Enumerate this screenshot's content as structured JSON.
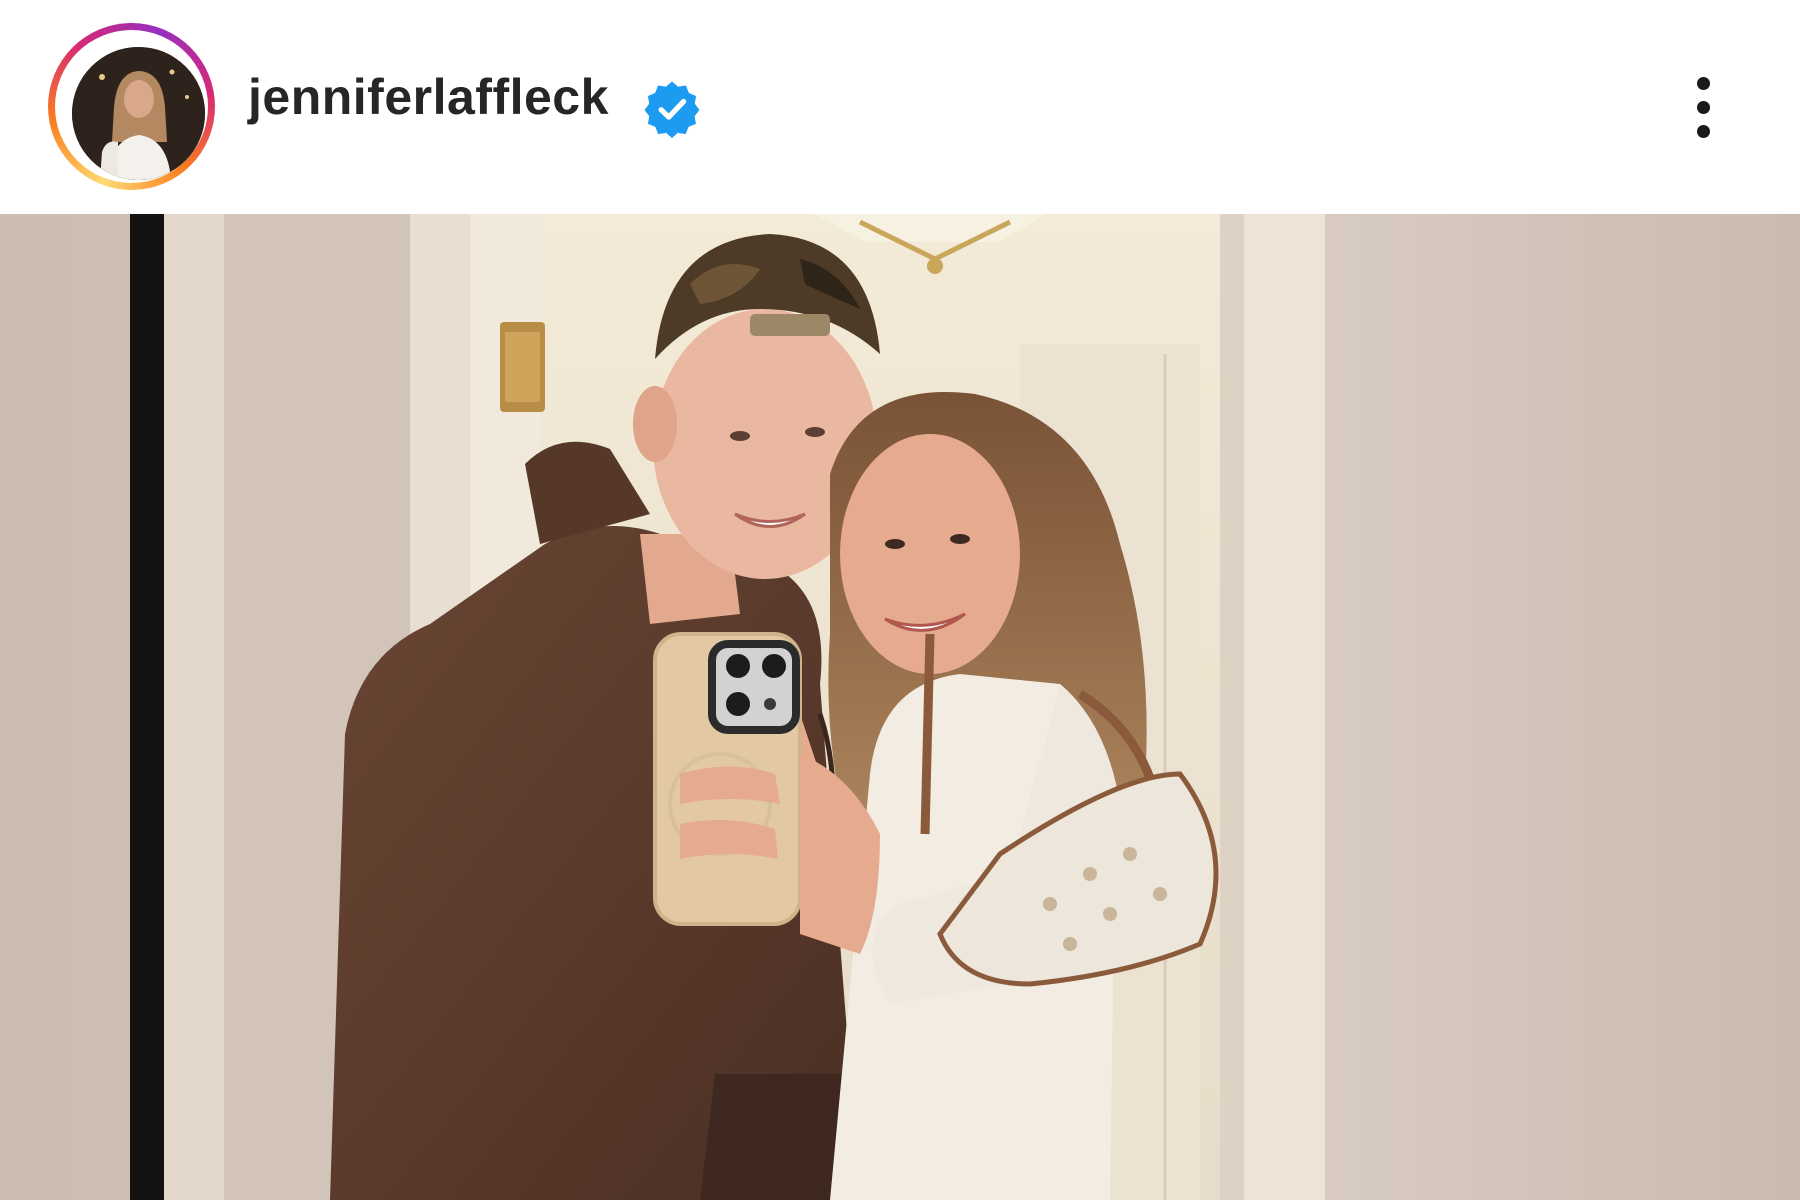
{
  "post": {
    "header": {
      "username": "jenniferlaffleck",
      "avatar_icon": "profile-photo",
      "verified_icon": "verified-badge-icon",
      "more_icon": "more-options-icon"
    },
    "photo": {
      "subject": "mirror-selfie-photo"
    }
  },
  "colors": {
    "username_text": "#262626",
    "verified_blue": "#1d9bf0",
    "story_ring_start": "#feda75",
    "story_ring_mid": "#d62976",
    "story_ring_end": "#962fbf"
  }
}
